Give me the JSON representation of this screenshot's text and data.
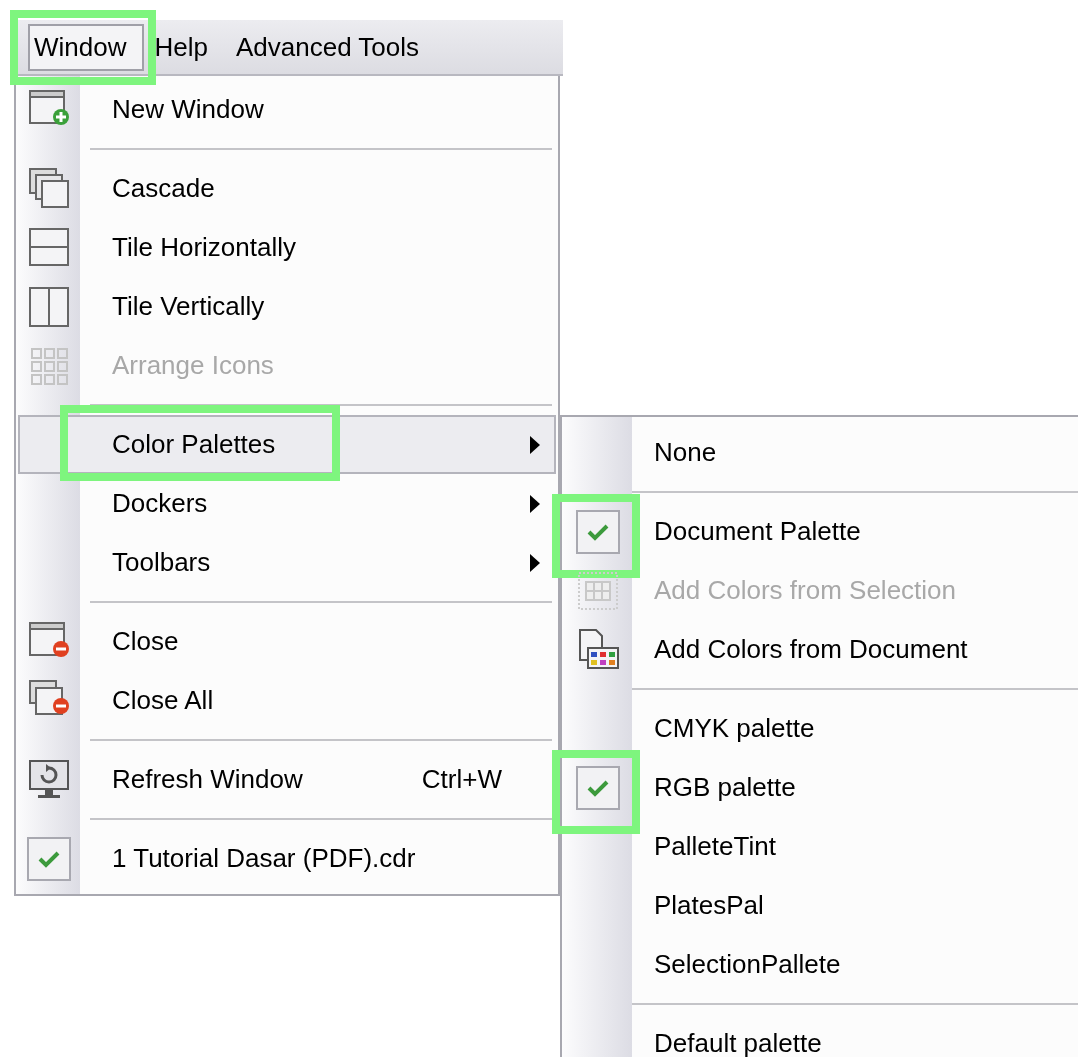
{
  "menu_bar": [
    {
      "label": "Window",
      "selected": true,
      "highlighted": true
    },
    {
      "label": "Help",
      "selected": false,
      "highlighted": false
    },
    {
      "label": "Advanced Tools",
      "selected": false,
      "highlighted": false
    }
  ],
  "menu": {
    "items": [
      {
        "kind": "item",
        "label": "New Window",
        "selected": false,
        "disabled": false,
        "checked": false,
        "highlighted": false
      },
      {
        "kind": "separator"
      },
      {
        "kind": "item",
        "label": "Cascade",
        "selected": false,
        "disabled": false,
        "checked": false,
        "highlighted": false
      },
      {
        "kind": "item",
        "label": "Tile Horizontally",
        "selected": false,
        "disabled": false,
        "checked": false,
        "highlighted": false
      },
      {
        "kind": "item",
        "label": "Tile Vertically",
        "selected": false,
        "disabled": false,
        "checked": false,
        "highlighted": false
      },
      {
        "kind": "item",
        "label": "Arrange Icons",
        "selected": false,
        "disabled": true,
        "checked": false,
        "highlighted": false
      },
      {
        "kind": "separator"
      },
      {
        "kind": "submenu",
        "label": "Color Palettes",
        "selected": true,
        "disabled": false,
        "checked": false,
        "highlighted": true,
        "submenu": {
          "items": [
            {
              "kind": "item",
              "label": "None",
              "selected": false,
              "disabled": false,
              "checked": false,
              "highlighted": false
            },
            {
              "kind": "separator"
            },
            {
              "kind": "item",
              "label": "Document Palette",
              "selected": false,
              "disabled": false,
              "checked": true,
              "highlighted": true
            },
            {
              "kind": "item",
              "label": "Add Colors from Selection",
              "selected": false,
              "disabled": true,
              "checked": false,
              "highlighted": false
            },
            {
              "kind": "item",
              "label": "Add Colors from Document",
              "selected": false,
              "disabled": false,
              "checked": false,
              "highlighted": false
            },
            {
              "kind": "separator"
            },
            {
              "kind": "item",
              "label": "CMYK palette",
              "selected": false,
              "disabled": false,
              "checked": false,
              "highlighted": false
            },
            {
              "kind": "item",
              "label": "RGB palette",
              "selected": false,
              "disabled": false,
              "checked": true,
              "highlighted": true
            },
            {
              "kind": "item",
              "label": "PalleteTint",
              "selected": false,
              "disabled": false,
              "checked": false,
              "highlighted": false
            },
            {
              "kind": "item",
              "label": "PlatesPal",
              "selected": false,
              "disabled": false,
              "checked": false,
              "highlighted": false
            },
            {
              "kind": "item",
              "label": "SelectionPallete",
              "selected": false,
              "disabled": false,
              "checked": false,
              "highlighted": false
            },
            {
              "kind": "separator"
            },
            {
              "kind": "item",
              "label": "Default palette",
              "selected": false,
              "disabled": false,
              "checked": false,
              "highlighted": false
            }
          ]
        }
      },
      {
        "kind": "submenu",
        "label": "Dockers",
        "selected": false,
        "disabled": false,
        "checked": false,
        "highlighted": false
      },
      {
        "kind": "submenu",
        "label": "Toolbars",
        "selected": false,
        "disabled": false,
        "checked": false,
        "highlighted": false
      },
      {
        "kind": "separator"
      },
      {
        "kind": "item",
        "label": "Close",
        "selected": false,
        "disabled": false,
        "checked": false,
        "highlighted": false
      },
      {
        "kind": "item",
        "label": "Close All",
        "selected": false,
        "disabled": false,
        "checked": false,
        "highlighted": false
      },
      {
        "kind": "separator"
      },
      {
        "kind": "item",
        "label": "Refresh Window",
        "shortcut": "Ctrl+W",
        "selected": false,
        "disabled": false,
        "checked": false,
        "highlighted": false
      },
      {
        "kind": "separator"
      },
      {
        "kind": "item",
        "label": "1 Tutorial Dasar (PDF).cdr",
        "selected": false,
        "disabled": false,
        "checked": true,
        "highlighted": false
      }
    ]
  }
}
